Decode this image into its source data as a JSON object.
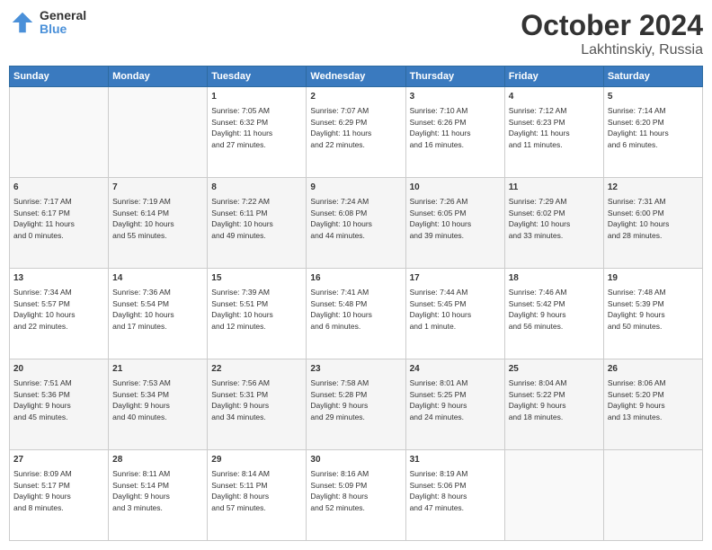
{
  "header": {
    "logo_general": "General",
    "logo_blue": "Blue",
    "month": "October 2024",
    "location": "Lakhtinskiy, Russia"
  },
  "weekdays": [
    "Sunday",
    "Monday",
    "Tuesday",
    "Wednesday",
    "Thursday",
    "Friday",
    "Saturday"
  ],
  "weeks": [
    [
      {
        "day": "",
        "info": ""
      },
      {
        "day": "",
        "info": ""
      },
      {
        "day": "1",
        "info": "Sunrise: 7:05 AM\nSunset: 6:32 PM\nDaylight: 11 hours\nand 27 minutes."
      },
      {
        "day": "2",
        "info": "Sunrise: 7:07 AM\nSunset: 6:29 PM\nDaylight: 11 hours\nand 22 minutes."
      },
      {
        "day": "3",
        "info": "Sunrise: 7:10 AM\nSunset: 6:26 PM\nDaylight: 11 hours\nand 16 minutes."
      },
      {
        "day": "4",
        "info": "Sunrise: 7:12 AM\nSunset: 6:23 PM\nDaylight: 11 hours\nand 11 minutes."
      },
      {
        "day": "5",
        "info": "Sunrise: 7:14 AM\nSunset: 6:20 PM\nDaylight: 11 hours\nand 6 minutes."
      }
    ],
    [
      {
        "day": "6",
        "info": "Sunrise: 7:17 AM\nSunset: 6:17 PM\nDaylight: 11 hours\nand 0 minutes."
      },
      {
        "day": "7",
        "info": "Sunrise: 7:19 AM\nSunset: 6:14 PM\nDaylight: 10 hours\nand 55 minutes."
      },
      {
        "day": "8",
        "info": "Sunrise: 7:22 AM\nSunset: 6:11 PM\nDaylight: 10 hours\nand 49 minutes."
      },
      {
        "day": "9",
        "info": "Sunrise: 7:24 AM\nSunset: 6:08 PM\nDaylight: 10 hours\nand 44 minutes."
      },
      {
        "day": "10",
        "info": "Sunrise: 7:26 AM\nSunset: 6:05 PM\nDaylight: 10 hours\nand 39 minutes."
      },
      {
        "day": "11",
        "info": "Sunrise: 7:29 AM\nSunset: 6:02 PM\nDaylight: 10 hours\nand 33 minutes."
      },
      {
        "day": "12",
        "info": "Sunrise: 7:31 AM\nSunset: 6:00 PM\nDaylight: 10 hours\nand 28 minutes."
      }
    ],
    [
      {
        "day": "13",
        "info": "Sunrise: 7:34 AM\nSunset: 5:57 PM\nDaylight: 10 hours\nand 22 minutes."
      },
      {
        "day": "14",
        "info": "Sunrise: 7:36 AM\nSunset: 5:54 PM\nDaylight: 10 hours\nand 17 minutes."
      },
      {
        "day": "15",
        "info": "Sunrise: 7:39 AM\nSunset: 5:51 PM\nDaylight: 10 hours\nand 12 minutes."
      },
      {
        "day": "16",
        "info": "Sunrise: 7:41 AM\nSunset: 5:48 PM\nDaylight: 10 hours\nand 6 minutes."
      },
      {
        "day": "17",
        "info": "Sunrise: 7:44 AM\nSunset: 5:45 PM\nDaylight: 10 hours\nand 1 minute."
      },
      {
        "day": "18",
        "info": "Sunrise: 7:46 AM\nSunset: 5:42 PM\nDaylight: 9 hours\nand 56 minutes."
      },
      {
        "day": "19",
        "info": "Sunrise: 7:48 AM\nSunset: 5:39 PM\nDaylight: 9 hours\nand 50 minutes."
      }
    ],
    [
      {
        "day": "20",
        "info": "Sunrise: 7:51 AM\nSunset: 5:36 PM\nDaylight: 9 hours\nand 45 minutes."
      },
      {
        "day": "21",
        "info": "Sunrise: 7:53 AM\nSunset: 5:34 PM\nDaylight: 9 hours\nand 40 minutes."
      },
      {
        "day": "22",
        "info": "Sunrise: 7:56 AM\nSunset: 5:31 PM\nDaylight: 9 hours\nand 34 minutes."
      },
      {
        "day": "23",
        "info": "Sunrise: 7:58 AM\nSunset: 5:28 PM\nDaylight: 9 hours\nand 29 minutes."
      },
      {
        "day": "24",
        "info": "Sunrise: 8:01 AM\nSunset: 5:25 PM\nDaylight: 9 hours\nand 24 minutes."
      },
      {
        "day": "25",
        "info": "Sunrise: 8:04 AM\nSunset: 5:22 PM\nDaylight: 9 hours\nand 18 minutes."
      },
      {
        "day": "26",
        "info": "Sunrise: 8:06 AM\nSunset: 5:20 PM\nDaylight: 9 hours\nand 13 minutes."
      }
    ],
    [
      {
        "day": "27",
        "info": "Sunrise: 8:09 AM\nSunset: 5:17 PM\nDaylight: 9 hours\nand 8 minutes."
      },
      {
        "day": "28",
        "info": "Sunrise: 8:11 AM\nSunset: 5:14 PM\nDaylight: 9 hours\nand 3 minutes."
      },
      {
        "day": "29",
        "info": "Sunrise: 8:14 AM\nSunset: 5:11 PM\nDaylight: 8 hours\nand 57 minutes."
      },
      {
        "day": "30",
        "info": "Sunrise: 8:16 AM\nSunset: 5:09 PM\nDaylight: 8 hours\nand 52 minutes."
      },
      {
        "day": "31",
        "info": "Sunrise: 8:19 AM\nSunset: 5:06 PM\nDaylight: 8 hours\nand 47 minutes."
      },
      {
        "day": "",
        "info": ""
      },
      {
        "day": "",
        "info": ""
      }
    ]
  ]
}
